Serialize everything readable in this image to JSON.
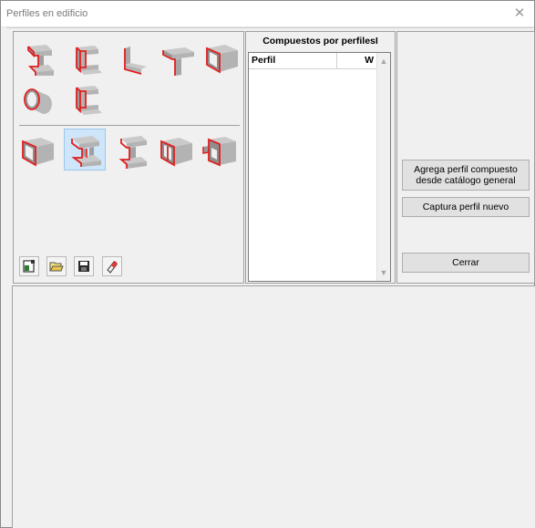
{
  "window": {
    "title": "Perfiles en edificio",
    "close_icon": "close-icon"
  },
  "shapes": {
    "simple": [
      "i-beam-profile-icon",
      "c-channel-profile-icon",
      "angle-profile-icon",
      "t-profile-icon",
      "box-profile-icon",
      "pipe-profile-icon",
      "c-channel-2-profile-icon"
    ],
    "compound": [
      "double-box-profile-icon",
      "double-i-profile-icon",
      "double-c-profile-icon",
      "box-compound-profile-icon",
      "box-flange-profile-icon"
    ],
    "selected": "double-i-profile-icon"
  },
  "toolbar": [
    "new-icon",
    "open-folder-icon",
    "save-icon",
    "eraser-icon"
  ],
  "list": {
    "title": "Compuestos por perfilesI",
    "col_perfil": "Perfil",
    "col_w": "W"
  },
  "actions": {
    "add_compound": "Agrega perfil compuesto desde catálogo general",
    "capture_new": "Captura perfil nuevo",
    "close": "Cerrar"
  },
  "colors": {
    "profile_edge": "#e02020",
    "profile_steel": "#b7b7b7",
    "selection": "#cfe5fa"
  }
}
